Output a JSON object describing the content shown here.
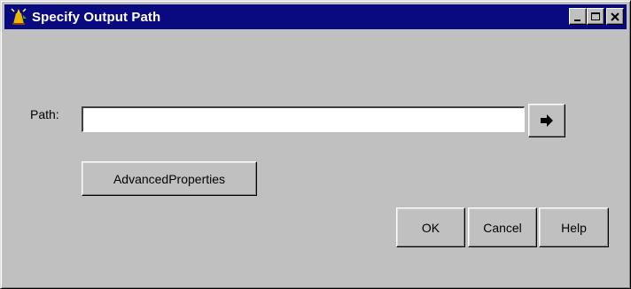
{
  "window": {
    "title": "Specify Output Path",
    "icon": "wizard-icon",
    "controls": {
      "minimize_icon": "minimize-icon",
      "maximize_icon": "maximize-icon",
      "close_icon": "close-icon"
    }
  },
  "form": {
    "path_label": "Path:",
    "path_value": "",
    "browse_icon": "arrow-right-icon"
  },
  "buttons": {
    "advanced_label": "AdvancedProperties",
    "ok_label": "OK",
    "cancel_label": "Cancel",
    "help_label": "Help"
  },
  "colors": {
    "titlebar": "#0a0a80",
    "dialog_face": "#c0c0c0"
  }
}
